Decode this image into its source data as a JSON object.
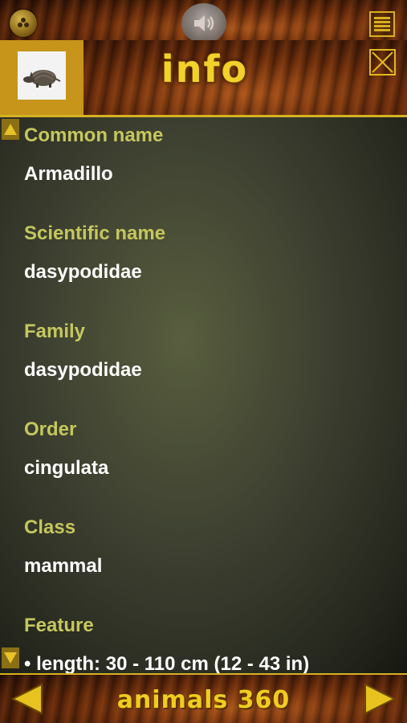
{
  "header": {
    "title": "info"
  },
  "fields": [
    {
      "label": "Common name",
      "value": "Armadillo"
    },
    {
      "label": "Scientific name",
      "value": "dasypodidae"
    },
    {
      "label": "Family",
      "value": "dasypodidae"
    },
    {
      "label": "Order",
      "value": "cingulata"
    },
    {
      "label": "Class",
      "value": "mammal"
    },
    {
      "label": "Feature",
      "value": "• length: 30 - 110 cm  (12 - 43 in)"
    }
  ],
  "footer": {
    "brand": "animals 360"
  },
  "icons": {
    "top_left": "home-icon",
    "sound": "speaker-icon",
    "menu": "menu-icon",
    "close": "close-icon",
    "prev": "arrow-left-icon",
    "next": "arrow-right-icon",
    "scroll_up": "scroll-up-icon",
    "scroll_down": "scroll-down-icon",
    "thumbnail": "armadillo-thumbnail"
  },
  "colors": {
    "accent_gold": "#d4b224",
    "label_green": "#c5c75d",
    "value_white": "#ffffff"
  }
}
